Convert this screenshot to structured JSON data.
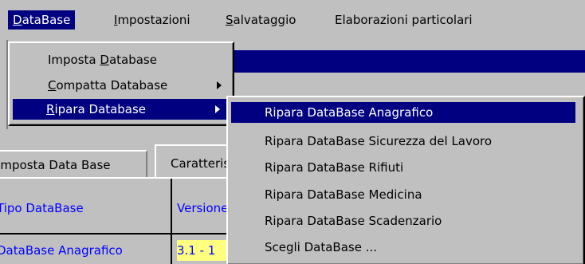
{
  "menubar": {
    "items": [
      {
        "label_pre": "",
        "label_u": "D",
        "label_post": "ataBase"
      },
      {
        "label_pre": "",
        "label_u": "I",
        "label_post": "mpostazioni"
      },
      {
        "label_pre": "",
        "label_u": "S",
        "label_post": "alvataggio"
      },
      {
        "label_pre": "",
        "label_u": "",
        "label_post": "Elaborazioni particolari"
      }
    ]
  },
  "database_menu": {
    "items": [
      {
        "label_pre": "Imposta ",
        "label_u": "D",
        "label_post": "atabase"
      },
      {
        "label_pre": "",
        "label_u": "C",
        "label_post": "ompatta Database"
      },
      {
        "label_pre": "",
        "label_u": "R",
        "label_post": "ipara Database"
      }
    ]
  },
  "ripara_submenu": {
    "items": [
      "Ripara DataBase Anagrafico",
      "Ripara DataBase Sicurezza del Lavoro",
      "Ripara DataBase Rifiuti",
      "Ripara DataBase Medicina",
      "Ripara DataBase Scadenzario",
      "Scegli DataBase ..."
    ]
  },
  "tabs": {
    "imposta": "Imposta Data Base",
    "caratteristiche": "Caratteristiche"
  },
  "grid": {
    "col1_header": "Tipo DataBase",
    "col2_header": "Versione",
    "row1_col1": "DataBase Anagrafico",
    "row1_col2": "3.1 - 1"
  },
  "colors": {
    "highlight": "#000080",
    "face": "#c0c0c0",
    "grid_text": "#0000ff",
    "selected_cell": "#ffff80"
  }
}
